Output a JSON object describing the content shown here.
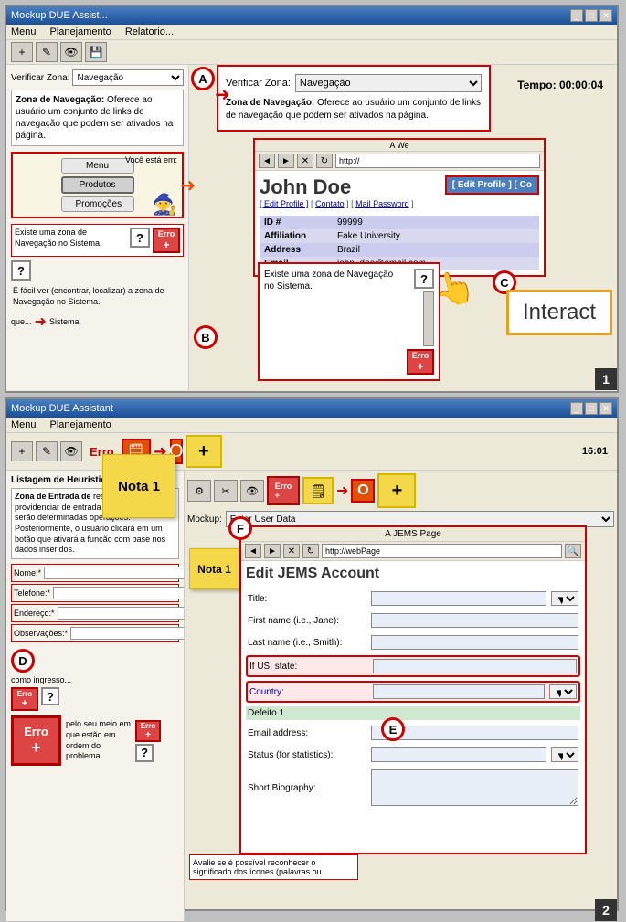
{
  "section1": {
    "title": "Mockup DUE Assist...",
    "menu_items": [
      "Menu",
      "Planejamento",
      "Relatorio..."
    ],
    "verificar_zona_label": "Verificar Zona:",
    "navegacao_option": "Navegação",
    "zona_desc_title": "Zona de Navegação:",
    "zona_desc_text": "Oferece ao usuário um conjunto de links de navegação que podem ser ativados na página.",
    "voce_esta_em": "Você está em:",
    "nav_items": [
      "Menu",
      "Produtos",
      "Promoções"
    ],
    "question_text1": "Existe uma zona de Navegação no Sistema.",
    "question_text2": "É fácil ver (encontrar, localizar) a zona de Navegação no Sistema.",
    "callout": {
      "verificar_label": "Verificar Zona:",
      "navegacao_value": "Navegação",
      "desc_title": "Zona de Navegação:",
      "desc_text": "Oferece ao usuário um conjunto de links de navegação que podem ser ativados na página.",
      "tempo_label": "Tempo: 00:00:04"
    },
    "browser": {
      "url": "http://",
      "profile_name": "John Doe",
      "links": "[ Edit Profile ] [ Contato ] [ Mail Password ]",
      "edit_profile_btn": "[ Edit Profile ] [ Co",
      "id_label": "ID #",
      "id_value": "99999",
      "affiliation_label": "Affiliation",
      "affiliation_value": "Fake University",
      "address_label": "Address",
      "address_value": "Brazil",
      "email_label": "Email",
      "email_value": "john_doe@email.com"
    },
    "interact_label": "Interact",
    "question_dialog": "Existe uma zona de Navegação no Sistema.",
    "erro_label": "Erro",
    "labels": {
      "A": "A",
      "B": "B",
      "C": "C",
      "num1": "1"
    }
  },
  "section2": {
    "title": "Mockup DUE Assistant",
    "menu_items": [
      "Menu",
      "Planejamento"
    ],
    "listagem_title": "Listagem de Heurísticas por...",
    "zona_entrada_title": "Zona de Entrada de",
    "zona_entrada_text": "responsável por providenciar de entrada de dados que serão determinadas operações. Posteriormente, o usuário clicará em um botão que ativará a função com base nos dados inseridos.",
    "form_fields": [
      {
        "label": "Nome:*",
        "value": ""
      },
      {
        "label": "Telefone:*",
        "value": ""
      },
      {
        "label": "Endereço:*",
        "value": ""
      },
      {
        "label": "Observações:*",
        "value": ""
      }
    ],
    "como_ingresso_label": "como ingresso...",
    "nota1_label": "Nota 1",
    "nota1_small_label": "Nota 1",
    "avalie_text": "Avalie se é possível reconhecer o significado dos ícones (palavras ou",
    "avalie_text2": "pelo seu meio em que estão ordem do problema.",
    "mockup_label": "Mockup:",
    "enter_user_data": "Enter User Data",
    "jems": {
      "page_title": "A JEMS Page",
      "url": "http://webPage",
      "form_title": "Edit JEMS Account",
      "fields": [
        {
          "label": "Title:",
          "has_select": true,
          "highlighted": false
        },
        {
          "label": "First name (i.e., Jane):",
          "has_select": false,
          "highlighted": false
        },
        {
          "label": "Last name (i.e., Smith):",
          "has_select": false,
          "highlighted": false
        },
        {
          "label": "If US, state:",
          "has_select": false,
          "highlighted": true
        },
        {
          "label": "Country:",
          "has_select": true,
          "highlighted": true
        },
        {
          "label": "Defeito 1",
          "has_select": false,
          "highlighted": false
        },
        {
          "label": "Email address:",
          "has_select": false,
          "highlighted": false
        },
        {
          "label": "Status (for statistics):",
          "has_select": true,
          "highlighted": false
        }
      ],
      "short_bio_label": "Short Biography:"
    },
    "labels": {
      "D": "D",
      "E": "E",
      "F": "F",
      "num2": "2"
    },
    "time_label": "16:01",
    "erro_label": "Erro"
  }
}
